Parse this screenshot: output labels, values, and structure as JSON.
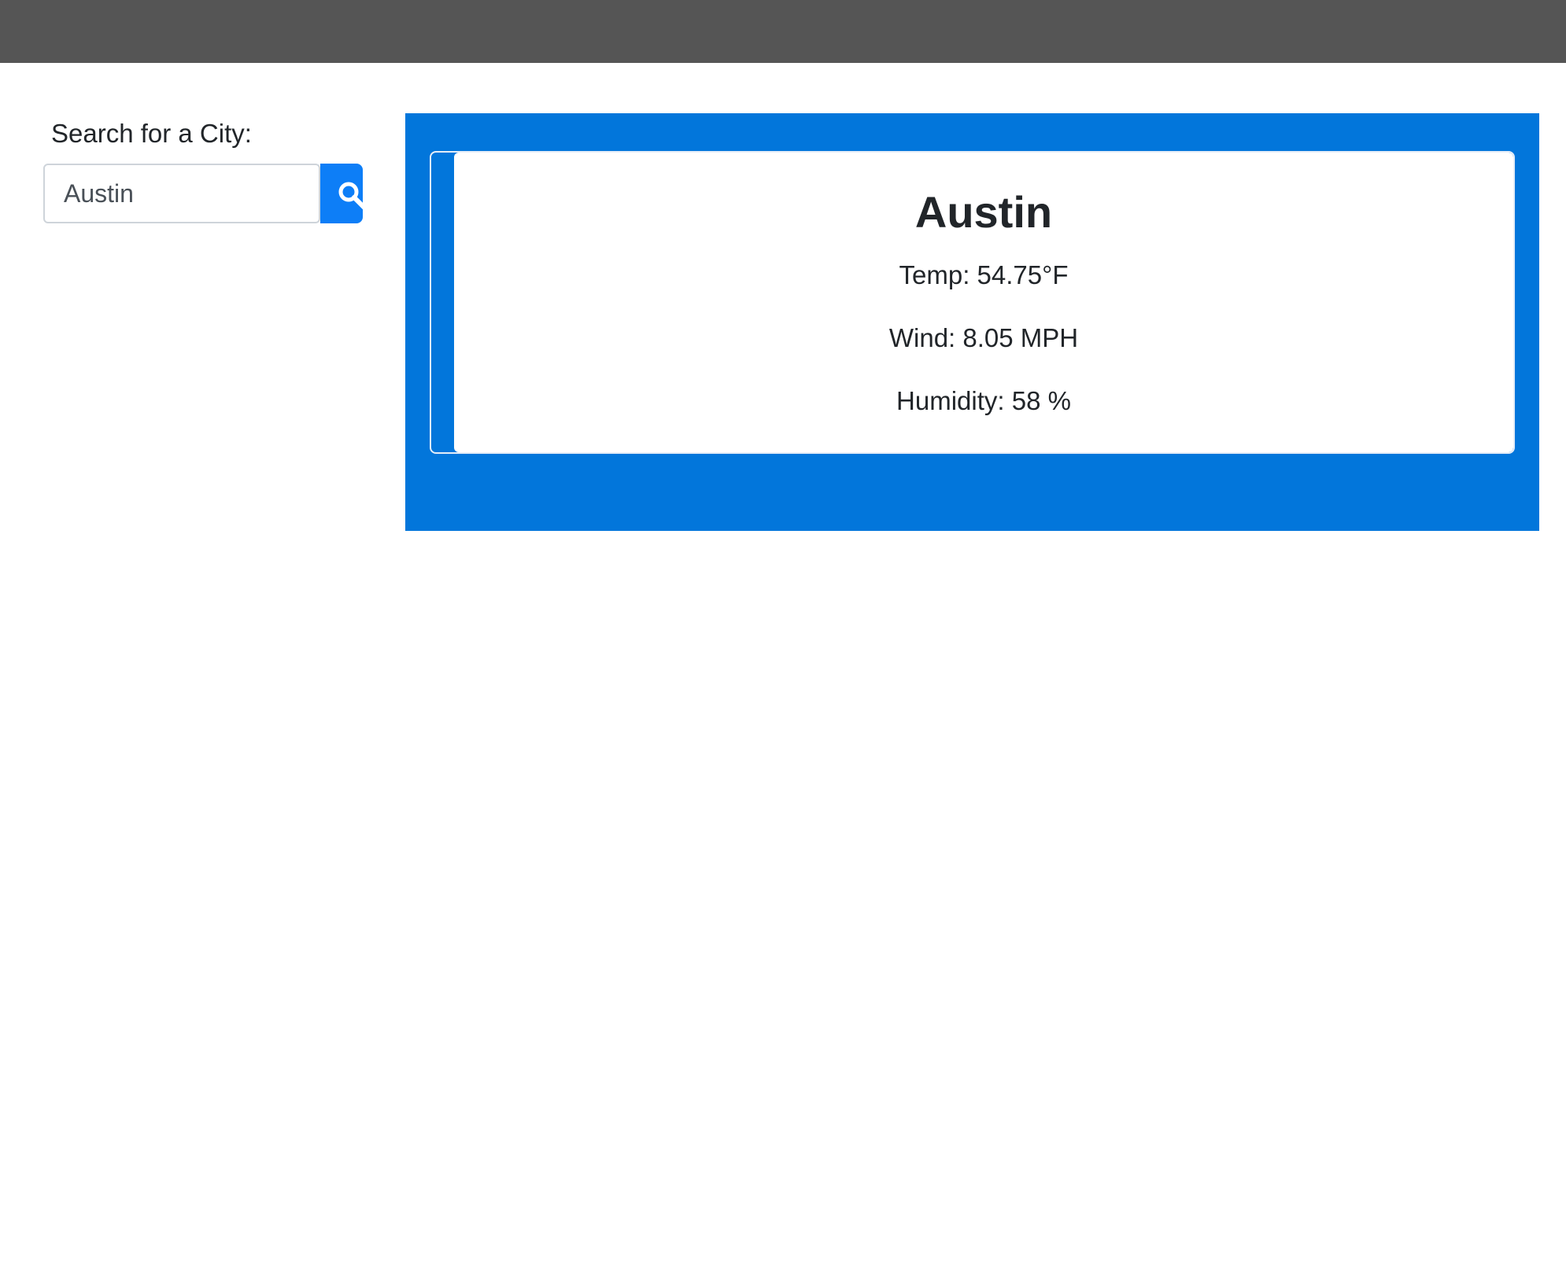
{
  "search": {
    "label": "Search for a City:",
    "input_value": "Austin",
    "placeholder": "",
    "button_icon": "search-icon"
  },
  "current_weather": {
    "city": "Austin",
    "temp": "Temp: 54.75°F",
    "wind": "Wind: 8.05 MPH",
    "humidity": "Humidity: 58 %"
  },
  "colors": {
    "topbar": "#555555",
    "panel_blue": "#0276db",
    "button_blue": "#0d7ef7",
    "text": "#212529"
  }
}
